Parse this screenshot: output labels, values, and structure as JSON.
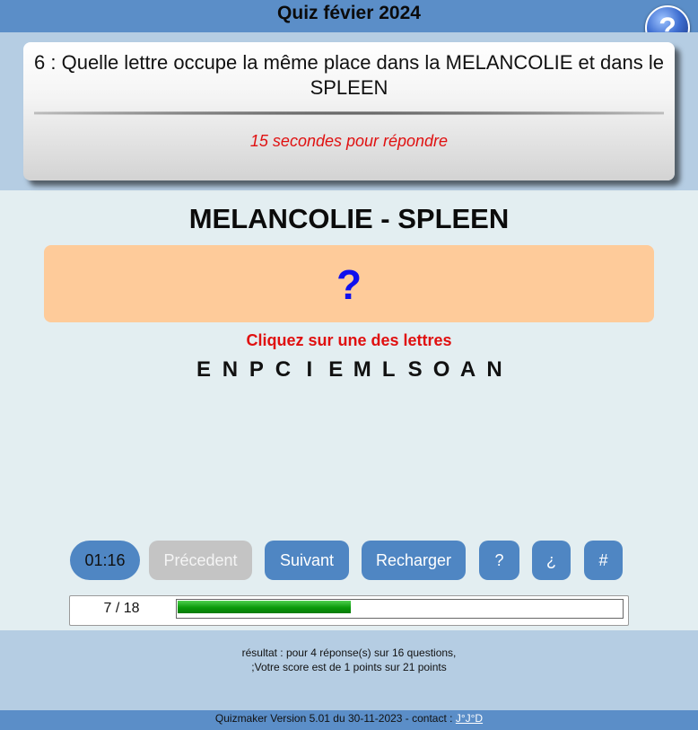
{
  "header": {
    "title": "Quiz févier 2024",
    "help_symbol": "?"
  },
  "question": {
    "text": "6 : Quelle lettre occupe la même place dans la MELANCOLIE et dans le SPLEEN",
    "time_notice": "15 secondes pour répondre"
  },
  "pair_title": "MELANCOLIE - SPLEEN",
  "answer_placeholder": "?",
  "instruction": "Cliquez sur une des lettres",
  "letters": [
    "E",
    "N",
    "P",
    "C",
    "I",
    "E",
    "M",
    "L",
    "S",
    "O",
    "A",
    "N"
  ],
  "controls": {
    "timer": "01:16",
    "previous": "Précedent",
    "next": "Suivant",
    "reload": "Recharger",
    "help_q": "?",
    "help_inv": "¿",
    "hash": "#"
  },
  "progress": {
    "label": "7 / 18",
    "current": 7,
    "total": 18
  },
  "result": {
    "line1": "résultat : pour 4 réponse(s) sur 16 questions,",
    "line2": ";Votre score est de 1 points sur 21 points"
  },
  "footer": {
    "text": "Quizmaker Version 5.01 du 30-11-2023 - contact : ",
    "link": "J°J°D"
  },
  "colors": {
    "header_bar": "#5b8ec8",
    "panel_bg": "#b5cde3",
    "body_bg": "#e3eef1",
    "answer_box": "#fecb9a",
    "button": "#4f86c3",
    "button_disabled": "#c4c4c4",
    "alert_red": "#e01010",
    "progress_green": "#0a9a0a"
  }
}
